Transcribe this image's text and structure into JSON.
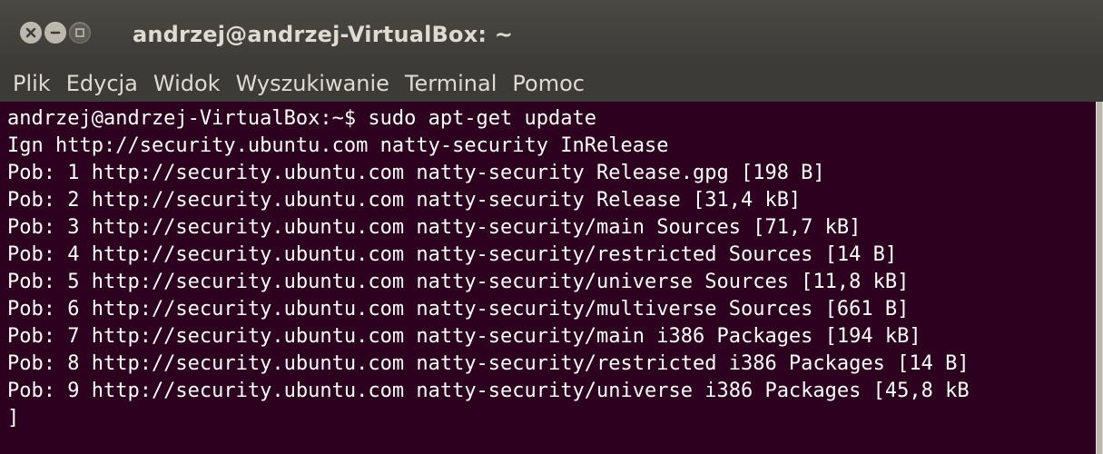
{
  "window": {
    "title": "andrzej@andrzej-VirtualBox: ~"
  },
  "controls": [
    {
      "name": "close",
      "icon": "close-icon"
    },
    {
      "name": "minimize",
      "icon": "minimize-icon"
    },
    {
      "name": "maximize",
      "icon": "maximize-icon"
    }
  ],
  "menubar": {
    "items": [
      "Plik",
      "Edycja",
      "Widok",
      "Wyszukiwanie",
      "Terminal",
      "Pomoc"
    ]
  },
  "terminal": {
    "lines": [
      "andrzej@andrzej-VirtualBox:~$ sudo apt-get update",
      "Ign http://security.ubuntu.com natty-security InRelease",
      "Pob: 1 http://security.ubuntu.com natty-security Release.gpg [198 B]",
      "Pob: 2 http://security.ubuntu.com natty-security Release [31,4 kB]",
      "Pob: 3 http://security.ubuntu.com natty-security/main Sources [71,7 kB]",
      "Pob: 4 http://security.ubuntu.com natty-security/restricted Sources [14 B]",
      "Pob: 5 http://security.ubuntu.com natty-security/universe Sources [11,8 kB]",
      "Pob: 6 http://security.ubuntu.com natty-security/multiverse Sources [661 B]",
      "Pob: 7 http://security.ubuntu.com natty-security/main i386 Packages [194 kB]",
      "Pob: 8 http://security.ubuntu.com natty-security/restricted i386 Packages [14 B]",
      "Pob: 9 http://security.ubuntu.com natty-security/universe i386 Packages [45,8 kB",
      "]"
    ]
  },
  "colors": {
    "terminal_bg": "#2c001e",
    "titlebar_bg": "#3c3b37",
    "text": "#ffffff",
    "menu_text": "#dfdbd2"
  }
}
